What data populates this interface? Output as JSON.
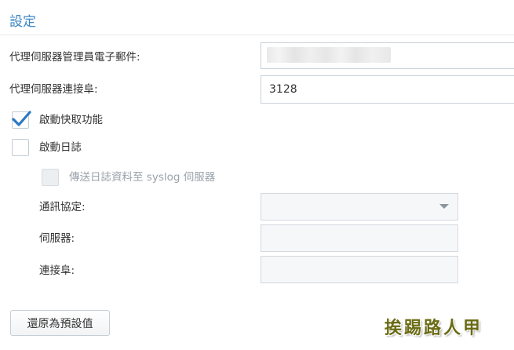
{
  "section": {
    "title": "設定"
  },
  "form": {
    "admin_email": {
      "label": "代理伺服器管理員電子郵件:",
      "value": ""
    },
    "proxy_port": {
      "label": "代理伺服器連接阜:",
      "value": "3128"
    },
    "enable_cache": {
      "label": "啟動快取功能",
      "checked": true
    },
    "enable_log": {
      "label": "啟動日誌",
      "checked": false
    },
    "send_syslog": {
      "label": "傳送日誌資料至 syslog 伺服器",
      "checked": false,
      "disabled": true
    },
    "protocol": {
      "label": "通訊協定:",
      "value": "",
      "icon": "chevron-down-icon"
    },
    "server": {
      "label": "伺服器:",
      "value": ""
    },
    "port": {
      "label": "連接阜:",
      "value": ""
    }
  },
  "buttons": {
    "reset_label": "還原為預設值"
  },
  "watermark": {
    "text": "挨踢路人甲"
  },
  "colors": {
    "accent": "#3e86c4",
    "checkmark": "#2b78c2",
    "border": "#c8d0d8",
    "disabled_text": "#9aa3ab"
  }
}
